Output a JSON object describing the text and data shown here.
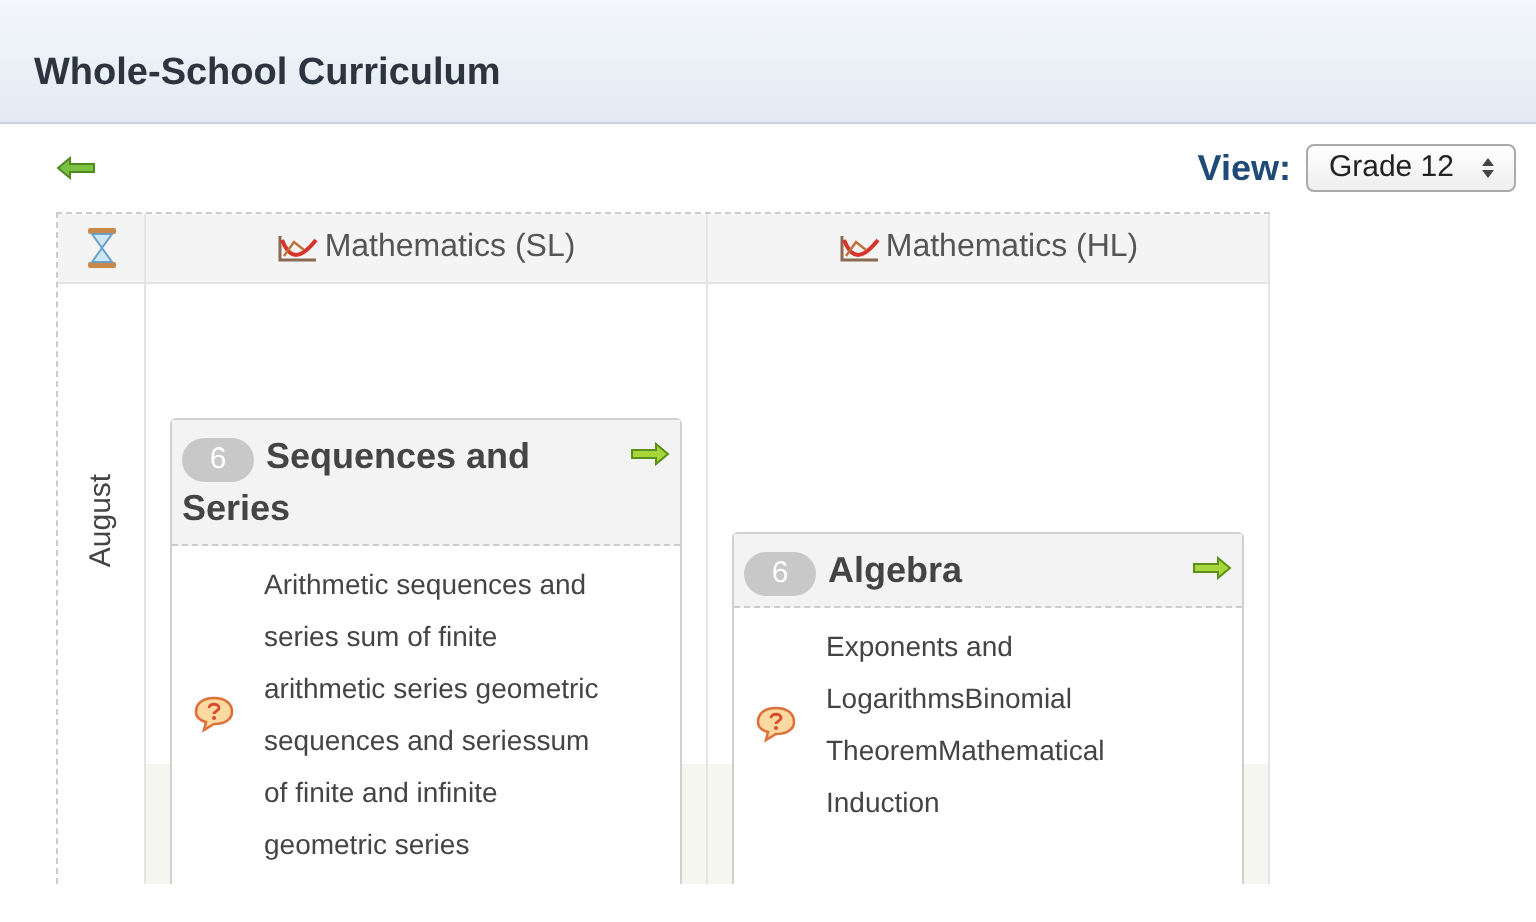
{
  "header": {
    "title": "Whole-School Curriculum"
  },
  "toolbar": {
    "view_label": "View:",
    "view_select": "Grade 12"
  },
  "table": {
    "columns": [
      {
        "title": "Mathematics (SL)",
        "units": [
          {
            "number": "6",
            "title": "Sequences and Series",
            "description": "Arithmetic sequences and series sum of finite arithmetic series geometric sequences and seriessum of finite and infinite geometric series"
          }
        ]
      },
      {
        "title": "Mathematics (HL)",
        "units": [
          {
            "number": "6",
            "title": "Algebra",
            "description": "Exponents and LogarithmsBinomial TheoremMathematical Induction"
          }
        ]
      }
    ],
    "rows": [
      {
        "month": "August"
      }
    ]
  }
}
